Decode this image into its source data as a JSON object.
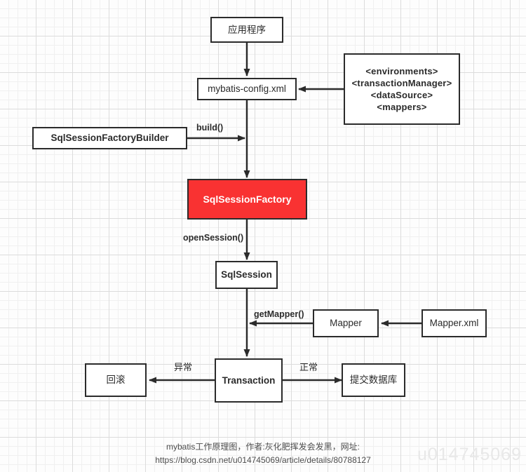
{
  "diagram": {
    "title": "mybatis工作原理图",
    "accent_color": "#f93232",
    "line_color": "#2b2b2b",
    "nodes": {
      "application": "应用程序",
      "config": "mybatis-config.xml",
      "config_elements": "<environments>\n<transactionManager>\n<dataSource>\n<mappers>",
      "builder": "SqlSessionFactoryBuilder",
      "factory": "SqlSessionFactory",
      "session": "SqlSession",
      "mapper": "Mapper",
      "mapper_xml": "Mapper.xml",
      "transaction": "Transaction",
      "rollback": "回滚",
      "commit": "提交数据库"
    },
    "edge_labels": {
      "build": "build()",
      "open_session": "openSession()",
      "get_mapper": "getMapper()",
      "exception": "异常",
      "normal": "正常"
    }
  },
  "caption": {
    "line1": "mybatis工作原理图，作者:灰化肥挥发会发黑，网址:",
    "line2": "https://blog.csdn.net/u014745069/article/details/80788127"
  },
  "watermark": {
    "text": "u014745069"
  }
}
